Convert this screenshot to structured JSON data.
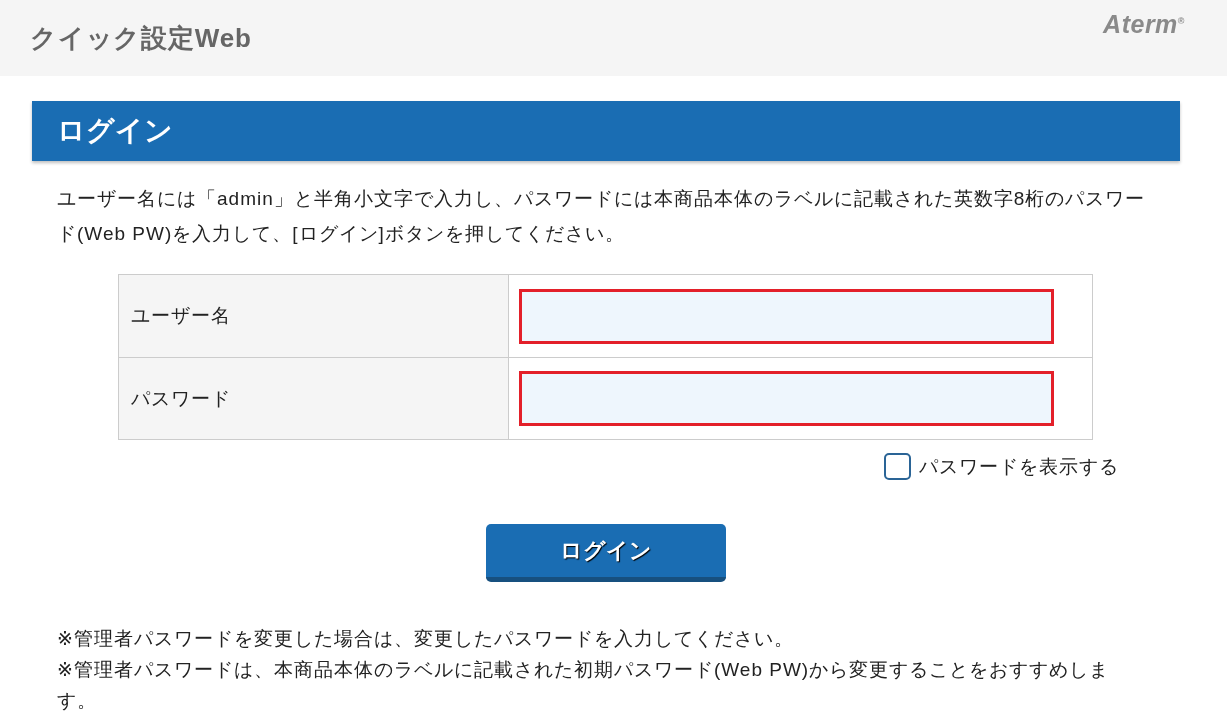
{
  "header": {
    "title": "クイック設定Web",
    "logo": "Aterm$^{®}$"
  },
  "panel": {
    "title": "ログイン"
  },
  "instructions": "ユーザー名には「admin」と半角小文字で入力し、パスワードには本商品本体のラベルに記載された英数字8桁のパスワード(Web PW)を入力して、[ログイン]ボタンを押してください。",
  "form": {
    "fields": [
      {
        "label": "ユーザー名"
      },
      {
        "label": "パスワード"
      }
    ]
  },
  "show_password": {
    "label": "パスワードを表示する",
    "checked": false
  },
  "login_button": "ログイン",
  "notes": [
    "※管理者パスワードを変更した場合は、変更したパスワードを入力してください。",
    "※管理者パスワードは、本商品本体のラベルに記載された初期パスワード(Web PW)から変更することをおすすめします。"
  ]
}
